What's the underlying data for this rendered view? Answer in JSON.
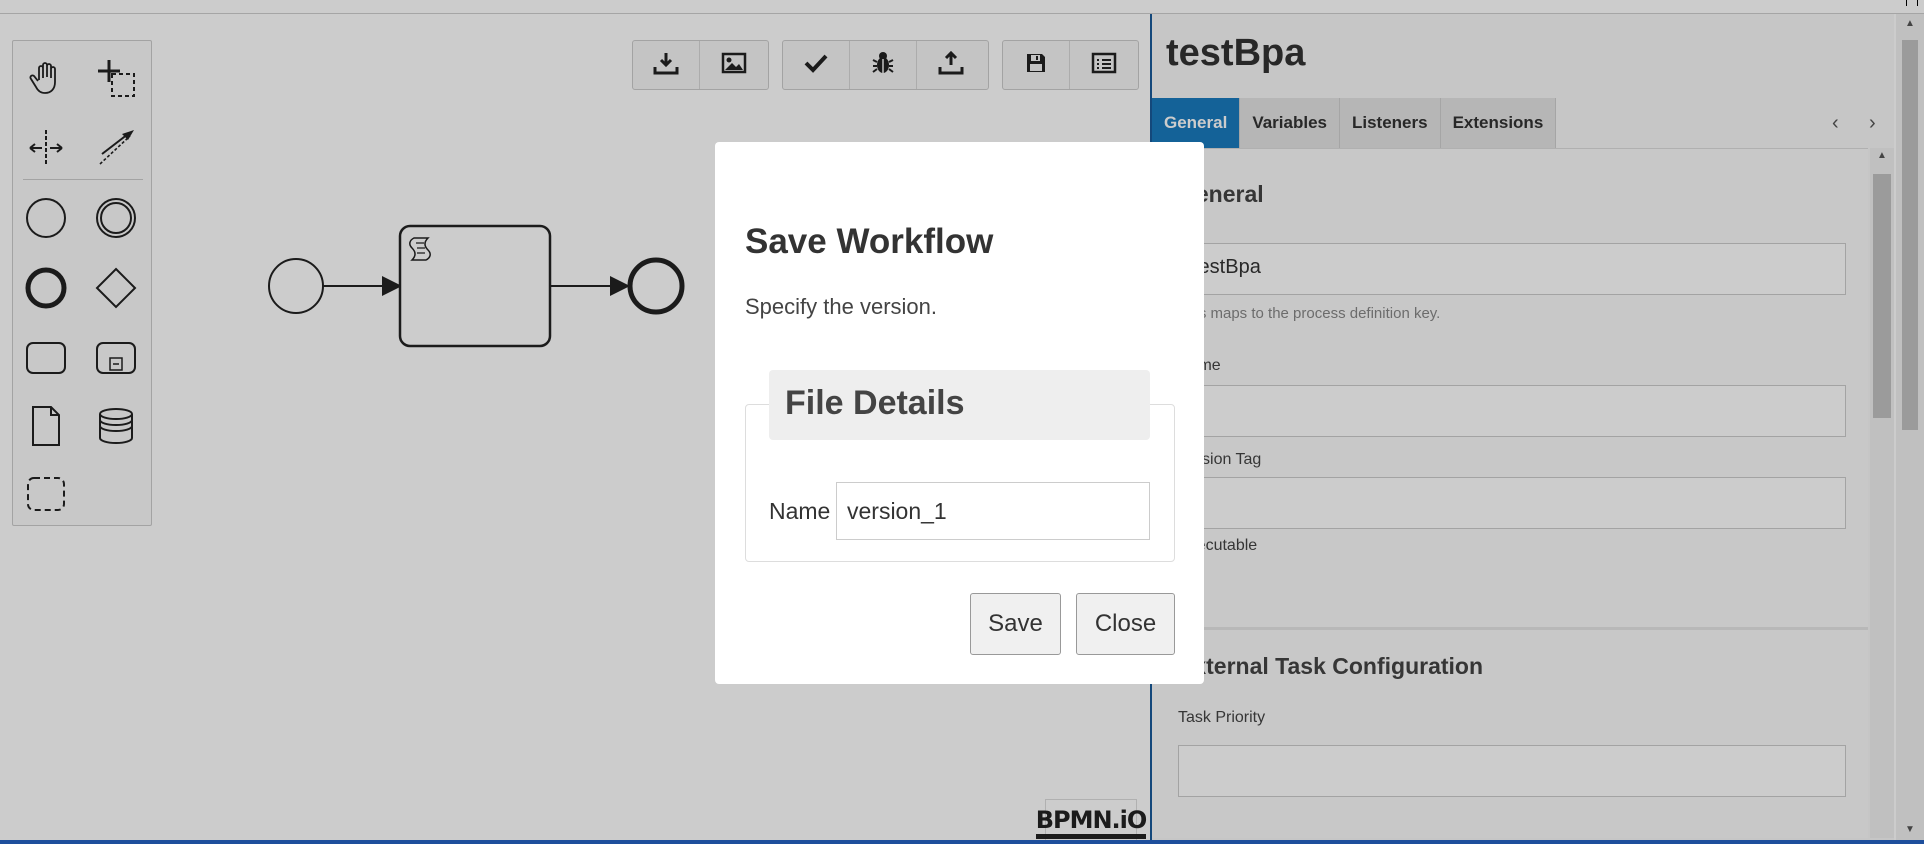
{
  "panel": {
    "title": "testBpa",
    "tabs": [
      {
        "label": "General",
        "active": true
      },
      {
        "label": "Variables",
        "active": false
      },
      {
        "label": "Listeners",
        "active": false
      },
      {
        "label": "Extensions",
        "active": false
      }
    ],
    "tab_prev": "‹",
    "tab_next": "›",
    "general": {
      "title": "General",
      "id_value": "testBpa",
      "id_desc": "This maps to the process definition key.",
      "name_label": "Name",
      "name_value": "",
      "version_tag_label": "Version Tag",
      "version_tag_value": "",
      "executable_label": "Executable"
    },
    "external_task": {
      "title": "External Task Configuration",
      "task_priority_label": "Task Priority",
      "task_priority_value": ""
    }
  },
  "logo": {
    "text": "BPMN.iO"
  },
  "modal": {
    "title": "Save Workflow",
    "subtitle": "Specify the version.",
    "legend": "File Details",
    "name_label": "Name",
    "name_value": "version_1",
    "save_label": "Save",
    "close_label": "Close"
  },
  "icons": {
    "palette": [
      "hand-tool-icon",
      "lasso-tool-icon",
      "space-tool-icon",
      "global-connect-icon",
      "start-event-icon",
      "intermediate-event-icon",
      "end-event-icon",
      "gateway-icon",
      "task-icon",
      "subprocess-icon",
      "data-object-icon",
      "data-store-icon",
      "group-icon"
    ],
    "toolbar": [
      "download-icon",
      "image-icon",
      "check-icon",
      "bug-icon",
      "upload-icon",
      "save-icon",
      "list-icon"
    ]
  },
  "colors": {
    "accent": "#1a7bbf",
    "overlay": "rgba(0,0,0,0.2)"
  }
}
